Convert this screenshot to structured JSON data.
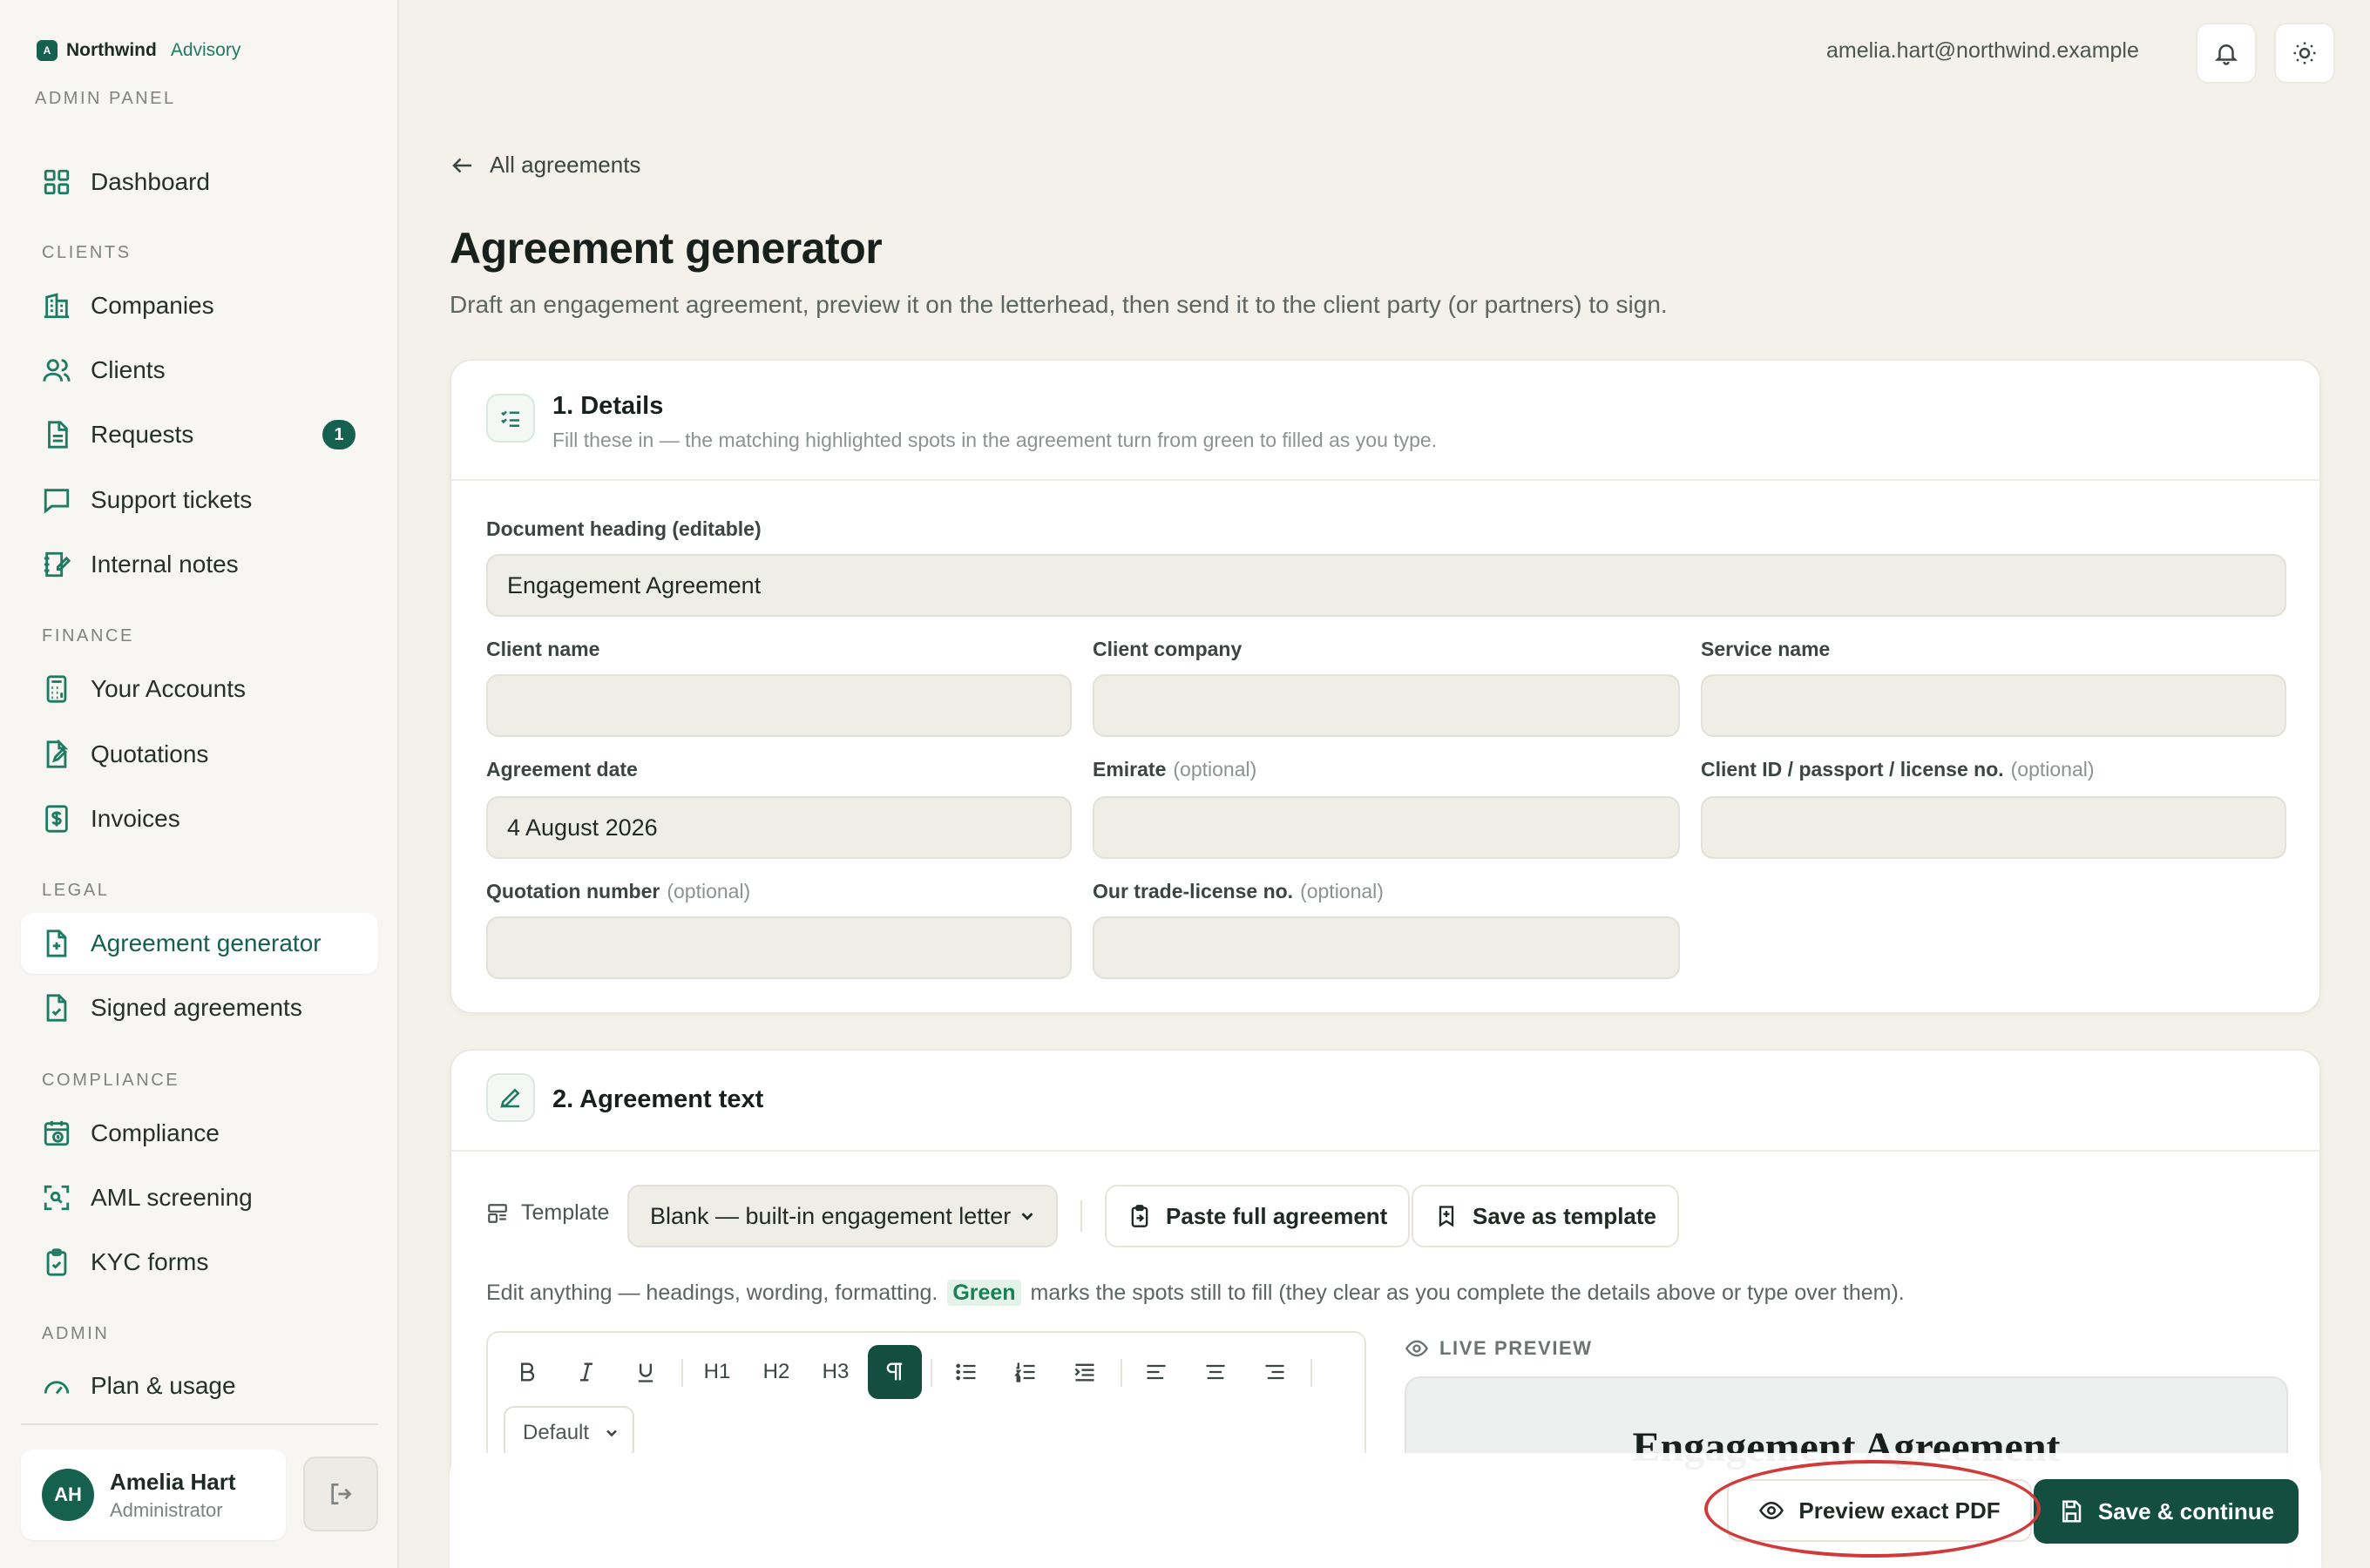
{
  "brand": {
    "logo_letter": "A",
    "name": "Northwind",
    "sub": "Advisory",
    "panel_label": "ADMIN PANEL"
  },
  "sidebar": {
    "items": [
      {
        "label": "Dashboard"
      },
      {
        "section": "CLIENTS"
      },
      {
        "label": "Companies"
      },
      {
        "label": "Clients"
      },
      {
        "label": "Requests",
        "badge": "1"
      },
      {
        "label": "Support tickets"
      },
      {
        "label": "Internal notes"
      },
      {
        "section": "FINANCE"
      },
      {
        "label": "Your Accounts"
      },
      {
        "label": "Quotations"
      },
      {
        "label": "Invoices"
      },
      {
        "section": "LEGAL"
      },
      {
        "label": "Agreement generator",
        "active": true
      },
      {
        "label": "Signed agreements"
      },
      {
        "section": "COMPLIANCE"
      },
      {
        "label": "Compliance"
      },
      {
        "label": "AML screening"
      },
      {
        "label": "KYC forms"
      },
      {
        "section": "ADMIN"
      },
      {
        "label": "Plan & usage"
      }
    ]
  },
  "user": {
    "initials": "AH",
    "name": "Amelia Hart",
    "role": "Administrator"
  },
  "topbar": {
    "email": "amelia.hart@northwind.example"
  },
  "page": {
    "back_label": "All agreements",
    "title": "Agreement generator",
    "description": "Draft an engagement agreement, preview it on the letterhead, then send it to the client party (or partners) to sign."
  },
  "details": {
    "title": "1. Details",
    "subtitle": "Fill these in — the matching highlighted spots in the agreement turn from green to filled as you type.",
    "heading_label": "Document heading (editable)",
    "heading_value": "Engagement Agreement",
    "fields": {
      "client_name": {
        "label": "Client name",
        "value": ""
      },
      "client_company": {
        "label": "Client company",
        "value": ""
      },
      "service_name": {
        "label": "Service name",
        "value": ""
      },
      "agreement_date": {
        "label": "Agreement date",
        "value": "4 August 2026"
      },
      "emirate": {
        "label": "Emirate",
        "optional": "(optional)",
        "value": ""
      },
      "client_id": {
        "label": "Client ID / passport / license no.",
        "optional": "(optional)",
        "value": ""
      },
      "quotation_number": {
        "label": "Quotation number",
        "optional": "(optional)",
        "value": ""
      },
      "trade_license": {
        "label": "Our trade-license no.",
        "optional": "(optional)",
        "value": ""
      }
    }
  },
  "agreement": {
    "title": "2. Agreement text",
    "template_label": "Template",
    "template_selected": "Blank — built-in engagement letter",
    "paste_label": "Paste full agreement",
    "save_template_label": "Save as template",
    "hint_before": "Edit anything — headings, wording, formatting.",
    "hint_green": "Green",
    "hint_after": "marks the spots still to fill (they clear as you complete the details above or type over them).",
    "toolbar": {
      "h1": "H1",
      "h2": "H2",
      "h3": "H3",
      "style_selected": "Default"
    },
    "live_preview_label": "LIVE PREVIEW",
    "preview_heading": "Engagement Agreement"
  },
  "actions": {
    "preview_label": "Preview exact PDF",
    "save_label": "Save & continue"
  },
  "colors": {
    "accent": "#15604f",
    "accent_dark": "#134e40",
    "annotation": "#d23a3a"
  }
}
